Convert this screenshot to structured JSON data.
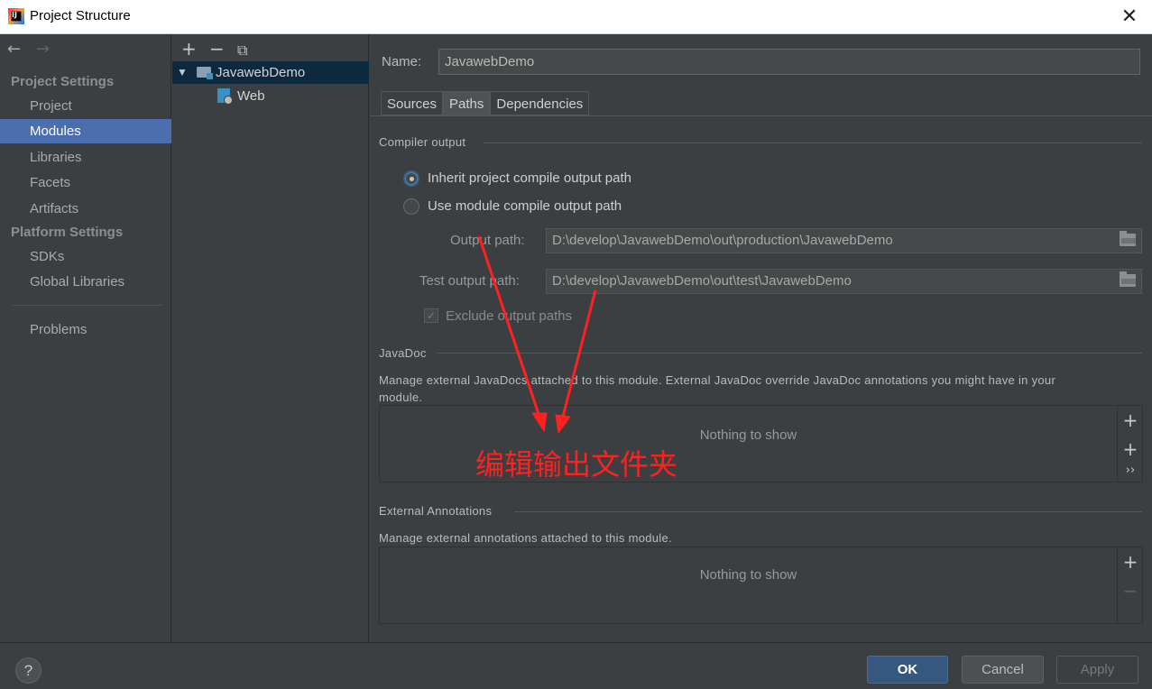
{
  "window": {
    "title": "Project Structure",
    "icon": "intellij-idea-icon",
    "close_glyph": "✕"
  },
  "nav": {
    "back_glyph": "←",
    "forward_glyph": "→",
    "project_settings_header": "Project Settings",
    "platform_settings_header": "Platform Settings",
    "items": [
      {
        "label": "Project",
        "selected": false
      },
      {
        "label": "Modules",
        "selected": true
      },
      {
        "label": "Libraries",
        "selected": false
      },
      {
        "label": "Facets",
        "selected": false
      },
      {
        "label": "Artifacts",
        "selected": false
      }
    ],
    "platform_items": [
      {
        "label": "SDKs"
      },
      {
        "label": "Global Libraries"
      }
    ],
    "problems": "Problems"
  },
  "tree": {
    "tools": {
      "add": "+",
      "remove": "−",
      "copy": "⧉"
    },
    "expand_glyph": "▼",
    "module": "JavawebDemo",
    "facet": "Web"
  },
  "module": {
    "name_label": "Name:",
    "name_value": "JavawebDemo",
    "tabs": [
      {
        "label": "Sources",
        "active": false
      },
      {
        "label": "Paths",
        "active": true
      },
      {
        "label": "Dependencies",
        "active": false
      }
    ],
    "compiler_output": {
      "section": "Compiler output",
      "inherit_label": "Inherit project compile output path",
      "inherit_selected": true,
      "use_module_label": "Use module compile output path",
      "output_path_label": "Output path:",
      "output_path_value": "D:\\develop\\JavawebDemo\\out\\production\\JavawebDemo",
      "test_output_path_label": "Test output path:",
      "test_output_path_value": "D:\\develop\\JavawebDemo\\out\\test\\JavawebDemo",
      "exclude_label": "Exclude output paths",
      "exclude_checked": true
    },
    "javadoc": {
      "section": "JavaDoc",
      "description_line1": "Manage external JavaDocs attached to this module. External JavaDoc override JavaDoc annotations you might have in your",
      "description_line2": "module.",
      "empty": "Nothing to show",
      "tool_add": "+",
      "tool_add_url": "+",
      "tool_more": "››"
    },
    "external_annotations": {
      "section": "External Annotations",
      "description": "Manage external annotations attached to this module.",
      "empty": "Nothing to show",
      "tool_add": "+",
      "tool_remove": "−"
    }
  },
  "footer": {
    "help": "?",
    "ok": "OK",
    "cancel": "Cancel",
    "apply": "Apply"
  },
  "annotation": {
    "text": "编辑输出文件夹",
    "color": "#ff2020"
  },
  "colors": {
    "background": "#3c3f41",
    "selection": "#4b6eaf",
    "ok_button": "#365880"
  }
}
